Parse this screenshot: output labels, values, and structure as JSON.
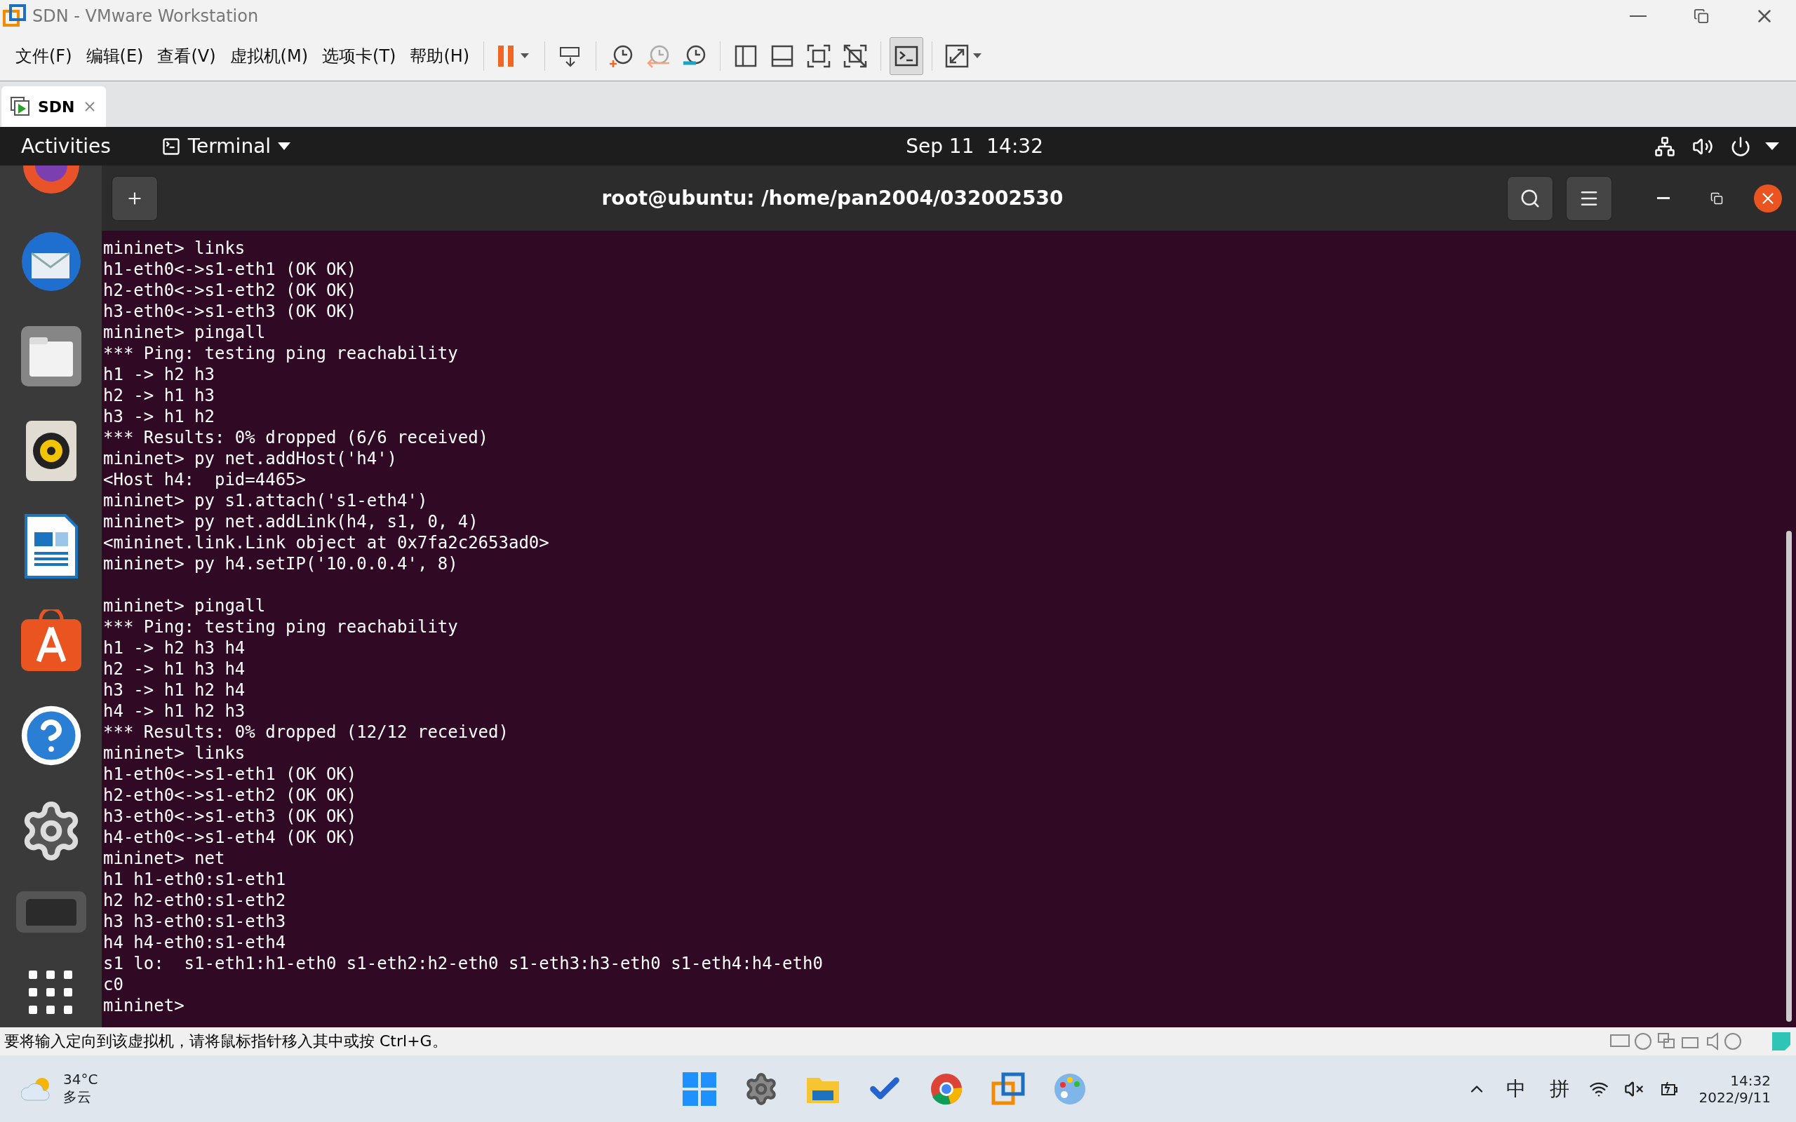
{
  "window": {
    "title": "SDN - VMware Workstation"
  },
  "menu": [
    "文件(F)",
    "编辑(E)",
    "查看(V)",
    "虚拟机(M)",
    "选项卡(T)",
    "帮助(H)"
  ],
  "tabs": [
    {
      "label": "SDN",
      "selected": true
    }
  ],
  "top_bar": {
    "activities": "Activities",
    "app_menu": "Terminal",
    "clock": "Sep 11  14:32"
  },
  "terminal": {
    "title": "root@ubuntu: /home/pan2004/032002530",
    "output_blocks": [
      {
        "lines": [
          "mininet> links",
          "h1-eth0<->s1-eth1 (OK OK)",
          "h2-eth0<->s1-eth2 (OK OK)",
          "h3-eth0<->s1-eth3 (OK OK)",
          "mininet> pingall",
          "*** Ping: testing ping reachability",
          "h1 -> h2 h3",
          "h2 -> h1 h3",
          "h3 -> h1 h2",
          "*** Results: 0% dropped (6/6 received)",
          "mininet> py net.addHost('h4')",
          "<Host h4:  pid=4465>",
          "mininet> py s1.attach('s1-eth4')",
          "mininet> py net.addLink(h4, s1, 0, 4)",
          "<mininet.link.Link object at 0x7fa2c2653ad0>",
          "mininet> py h4.setIP('10.0.0.4', 8)"
        ]
      },
      {
        "lines": [
          "mininet> pingall",
          "*** Ping: testing ping reachability",
          "h1 -> h2 h3 h4",
          "h2 -> h1 h3 h4",
          "h3 -> h1 h2 h4",
          "h4 -> h1 h2 h3",
          "*** Results: 0% dropped (12/12 received)",
          "mininet> links",
          "h1-eth0<->s1-eth1 (OK OK)",
          "h2-eth0<->s1-eth2 (OK OK)",
          "h3-eth0<->s1-eth3 (OK OK)",
          "h4-eth0<->s1-eth4 (OK OK)",
          "mininet> net",
          "h1 h1-eth0:s1-eth1",
          "h2 h2-eth0:s1-eth2",
          "h3 h3-eth0:s1-eth3",
          "h4 h4-eth0:s1-eth4",
          "s1 lo:  s1-eth1:h1-eth0 s1-eth2:h2-eth0 s1-eth3:h3-eth0 s1-eth4:h4-eth0",
          "c0",
          "mininet>"
        ]
      }
    ]
  },
  "status_bar": {
    "text": "要将输入定向到该虚拟机，请将鼠标指针移入其中或按 Ctrl+G。"
  },
  "taskbar": {
    "temperature": "34°C",
    "weather": "多云",
    "input_mode": "中",
    "ime": "拼",
    "time": "14:32",
    "date": "2022/9/11"
  }
}
